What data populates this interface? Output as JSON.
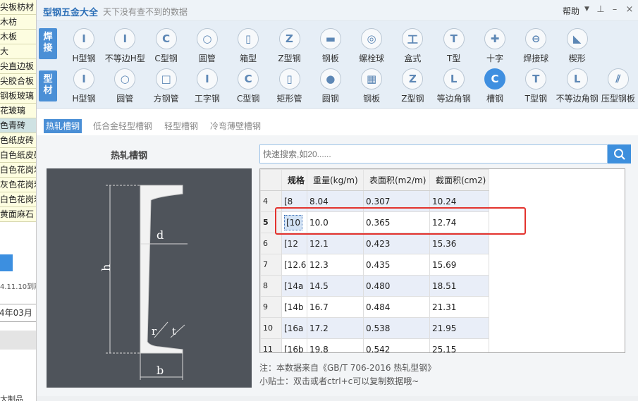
{
  "left_panel": {
    "items": [
      "尖板枋材",
      "木枋",
      "木板",
      "大",
      "尖直边板",
      "尖胶合板",
      "钢板玻璃",
      "花玻璃",
      "色青砖",
      "色纸皮砖",
      "白色纸皮砖",
      "白色花岗岩",
      "灰色花岗岩",
      "白色花岗岩",
      "黄面麻石"
    ],
    "selected_index": 8,
    "date_text": "4.11.10到期",
    "date_value": "4年03月",
    "bottom_label": "大制品"
  },
  "window": {
    "title": "型钢五金大全",
    "subtitle": "天下没有查不到的数据",
    "help_label": "帮助"
  },
  "toolbar": {
    "group1_label": "焊接",
    "group2_label": "型材",
    "row1": [
      {
        "label": "H型钢",
        "glyph": "I"
      },
      {
        "label": "不等边H型",
        "glyph": "I"
      },
      {
        "label": "C型钢",
        "glyph": "C"
      },
      {
        "label": "圆管",
        "glyph": "○"
      },
      {
        "label": "箱型",
        "glyph": "▯"
      },
      {
        "label": "Z型钢",
        "glyph": "Z"
      },
      {
        "label": "钢板",
        "glyph": "▬"
      },
      {
        "label": "螺栓球",
        "glyph": "◎"
      },
      {
        "label": "盒式",
        "glyph": "工"
      },
      {
        "label": "T型",
        "glyph": "T"
      },
      {
        "label": "十字",
        "glyph": "✚"
      },
      {
        "label": "焊接球",
        "glyph": "⊖"
      },
      {
        "label": "楔形",
        "glyph": "◣"
      }
    ],
    "row2": [
      {
        "label": "H型钢",
        "glyph": "I"
      },
      {
        "label": "圆管",
        "glyph": "○"
      },
      {
        "label": "方钢管",
        "glyph": "□"
      },
      {
        "label": "工字钢",
        "glyph": "I"
      },
      {
        "label": "C型钢",
        "glyph": "C"
      },
      {
        "label": "矩形管",
        "glyph": "▯"
      },
      {
        "label": "圆钢",
        "glyph": "●"
      },
      {
        "label": "钢板",
        "glyph": "▦"
      },
      {
        "label": "Z型钢",
        "glyph": "Z"
      },
      {
        "label": "等边角钢",
        "glyph": "L"
      },
      {
        "label": "槽钢",
        "glyph": "C"
      },
      {
        "label": "T型钢",
        "glyph": "T"
      },
      {
        "label": "不等边角钢",
        "glyph": "L"
      },
      {
        "label": "压型钢板",
        "glyph": "⫽"
      }
    ],
    "active_row2_index": 10
  },
  "tabs": [
    "热轧槽钢",
    "低合金轻型槽钢",
    "轻型槽钢",
    "冷弯薄壁槽钢"
  ],
  "active_tab": 0,
  "diagram": {
    "title": "热轧槽钢",
    "labels": {
      "d": "d",
      "h": "h",
      "r": "r",
      "t": "t",
      "b": "b"
    }
  },
  "search": {
    "placeholder": "快速搜索,如20......"
  },
  "table": {
    "columns": [
      "规格",
      "重量(kg/m)",
      "表面积(m2/m)",
      "截面积(cm2)"
    ],
    "rows": [
      {
        "n": "4",
        "spec": "[8",
        "weight": "8.04",
        "surface": "0.307",
        "area": "10.24"
      },
      {
        "n": "5",
        "spec": "[10",
        "weight": "10.0",
        "surface": "0.365",
        "area": "12.74"
      },
      {
        "n": "6",
        "spec": "[12",
        "weight": "12.1",
        "surface": "0.423",
        "area": "15.36"
      },
      {
        "n": "7",
        "spec": "[12.6",
        "weight": "12.3",
        "surface": "0.435",
        "area": "15.69"
      },
      {
        "n": "8",
        "spec": "[14a",
        "weight": "14.5",
        "surface": "0.480",
        "area": "18.51"
      },
      {
        "n": "9",
        "spec": "[14b",
        "weight": "16.7",
        "surface": "0.484",
        "area": "21.31"
      },
      {
        "n": "10",
        "spec": "[16a",
        "weight": "17.2",
        "surface": "0.538",
        "area": "21.95"
      },
      {
        "n": "11",
        "spec": "[16b",
        "weight": "19.8",
        "surface": "0.542",
        "area": "25.15"
      }
    ],
    "selected_row": 1
  },
  "footer": {
    "note": "注：本数据来自《GB/T 706-2016 热轧型钢》",
    "tip": "小贴士：双击或者ctrl+c可以复制数据哦~"
  },
  "colors": {
    "accent": "#3f8fe0",
    "highlight": "#e3332e",
    "diagram_bg": "#4f545b"
  }
}
